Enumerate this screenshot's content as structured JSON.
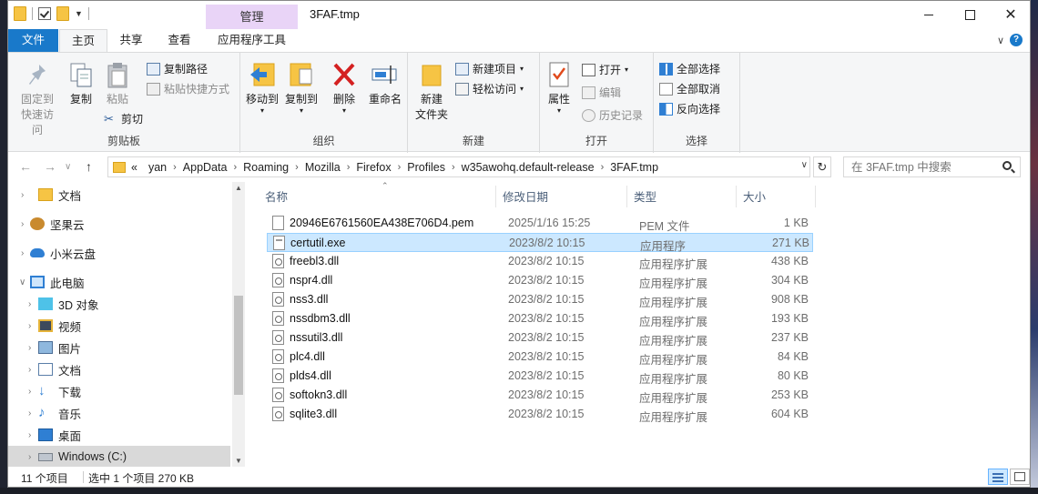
{
  "window": {
    "title": "3FAF.tmp",
    "context_tab": "管理"
  },
  "ribbon_tabs": [
    "文件",
    "主页",
    "共享",
    "查看",
    "应用程序工具"
  ],
  "ribbon": {
    "clipboard": {
      "pin": "固定到快速访问",
      "copy": "复制",
      "paste": "粘贴",
      "copy_path": "复制路径",
      "paste_shortcut": "粘贴快捷方式",
      "cut": "剪切",
      "label": "剪贴板"
    },
    "organize": {
      "move_to": "移动到",
      "copy_to": "复制到",
      "delete": "删除",
      "rename": "重命名",
      "label": "组织"
    },
    "new": {
      "new_folder_line1": "新建",
      "new_folder_line2": "文件夹",
      "new_item": "新建项目",
      "easy_access": "轻松访问",
      "label": "新建"
    },
    "open": {
      "properties": "属性",
      "open": "打开",
      "edit": "编辑",
      "history": "历史记录",
      "label": "打开"
    },
    "select": {
      "select_all": "全部选择",
      "select_none": "全部取消",
      "invert": "反向选择",
      "label": "选择"
    }
  },
  "address": {
    "overflow": "«",
    "crumbs": [
      "yan",
      "AppData",
      "Roaming",
      "Mozilla",
      "Firefox",
      "Profiles",
      "w35awohq.default-release",
      "3FAF.tmp"
    ],
    "search_placeholder": "在 3FAF.tmp 中搜索"
  },
  "nav": [
    {
      "label": "文档",
      "icon": "folder-icon"
    },
    {
      "label": "坚果云",
      "icon": "nutstore-icon"
    },
    {
      "label": "小米云盘",
      "icon": "cloud-icon"
    },
    {
      "label": "此电脑",
      "icon": "computer-icon"
    },
    {
      "label": "3D 对象",
      "icon": "cube-icon"
    },
    {
      "label": "视频",
      "icon": "video-icon"
    },
    {
      "label": "图片",
      "icon": "picture-icon"
    },
    {
      "label": "文档",
      "icon": "document-icon"
    },
    {
      "label": "下载",
      "icon": "download-icon"
    },
    {
      "label": "音乐",
      "icon": "music-icon"
    },
    {
      "label": "桌面",
      "icon": "desktop-icon"
    },
    {
      "label": "Windows (C:)",
      "icon": "drive-icon"
    }
  ],
  "columns": {
    "name": "名称",
    "date": "修改日期",
    "type": "类型",
    "size": "大小"
  },
  "files": [
    {
      "name": "20946E6761560EA438E706D4.pem",
      "date": "2025/1/16 15:25",
      "type": "PEM 文件",
      "size": "1 KB",
      "icon": "pem"
    },
    {
      "name": "certutil.exe",
      "date": "2023/8/2 10:15",
      "type": "应用程序",
      "size": "271 KB",
      "icon": "exe"
    },
    {
      "name": "freebl3.dll",
      "date": "2023/8/2 10:15",
      "type": "应用程序扩展",
      "size": "438 KB",
      "icon": "dll"
    },
    {
      "name": "nspr4.dll",
      "date": "2023/8/2 10:15",
      "type": "应用程序扩展",
      "size": "304 KB",
      "icon": "dll"
    },
    {
      "name": "nss3.dll",
      "date": "2023/8/2 10:15",
      "type": "应用程序扩展",
      "size": "908 KB",
      "icon": "dll"
    },
    {
      "name": "nssdbm3.dll",
      "date": "2023/8/2 10:15",
      "type": "应用程序扩展",
      "size": "193 KB",
      "icon": "dll"
    },
    {
      "name": "nssutil3.dll",
      "date": "2023/8/2 10:15",
      "type": "应用程序扩展",
      "size": "237 KB",
      "icon": "dll"
    },
    {
      "name": "plc4.dll",
      "date": "2023/8/2 10:15",
      "type": "应用程序扩展",
      "size": "84 KB",
      "icon": "dll"
    },
    {
      "name": "plds4.dll",
      "date": "2023/8/2 10:15",
      "type": "应用程序扩展",
      "size": "80 KB",
      "icon": "dll"
    },
    {
      "name": "softokn3.dll",
      "date": "2023/8/2 10:15",
      "type": "应用程序扩展",
      "size": "253 KB",
      "icon": "dll"
    },
    {
      "name": "sqlite3.dll",
      "date": "2023/8/2 10:15",
      "type": "应用程序扩展",
      "size": "604 KB",
      "icon": "dll"
    }
  ],
  "status": {
    "count": "11 个项目",
    "selection": "选中 1 个项目  270 KB"
  }
}
